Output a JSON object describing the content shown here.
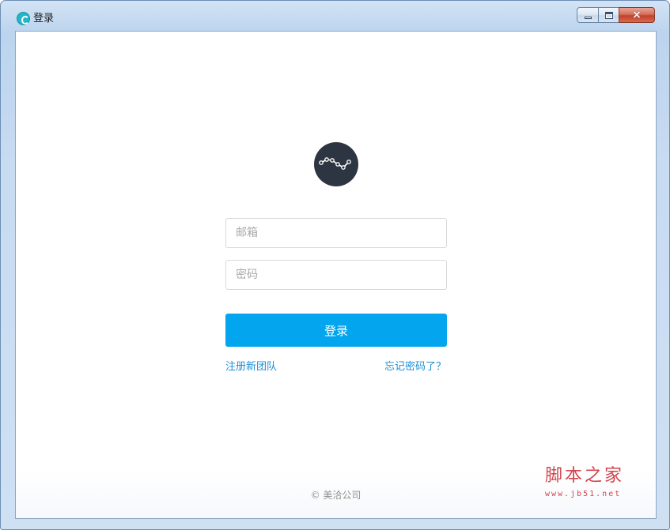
{
  "window": {
    "title": "登录",
    "close_glyph": "×"
  },
  "icons": {
    "app": "app-logo-icon",
    "logo": "trend-line-icon",
    "minimize": "minimize-icon",
    "maximize": "maximize-icon",
    "close": "close-icon"
  },
  "colors": {
    "primary": "#03a6ee",
    "link": "#1d8fd8",
    "logo_bg": "#2c3541",
    "watermark": "#d3454f"
  },
  "form": {
    "email_placeholder": "邮箱",
    "password_placeholder": "密码",
    "login_label": "登录",
    "register_link": "注册新团队",
    "forgot_link": "忘记密码了？"
  },
  "footer": {
    "copyright": "© 美洽公司"
  },
  "watermark": {
    "name": "脚本之家",
    "url": "www.jb51.net"
  }
}
